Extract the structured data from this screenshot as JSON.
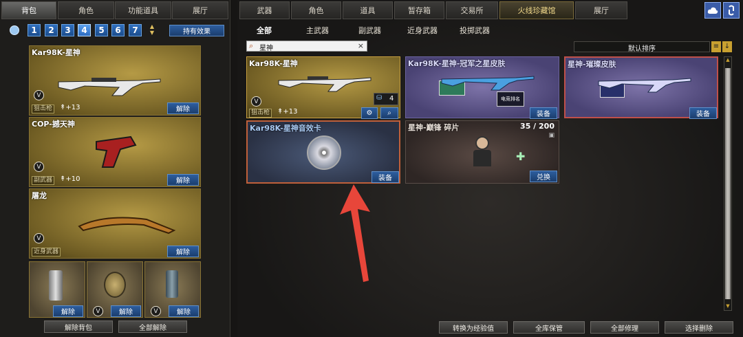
{
  "left": {
    "tabs": [
      "背包",
      "角色",
      "功能道具",
      "展厅"
    ],
    "bag_numbers": [
      "1",
      "2",
      "3",
      "4",
      "5",
      "6",
      "7"
    ],
    "active_bag": "4",
    "effect_btn": "持有效果",
    "slots": [
      {
        "name": "Kar98K-星神",
        "type": "狙击枪",
        "enh": "+13",
        "btn": "解除"
      },
      {
        "name": "COP-撼天神",
        "type": "副武器",
        "enh": "+10",
        "btn": "解除"
      },
      {
        "name": "屠龙",
        "type": "近身武器",
        "btn": "解除"
      }
    ],
    "grenades": [
      {
        "btn": "解除"
      },
      {
        "btn": "解除"
      },
      {
        "btn": "解除"
      }
    ],
    "bottom_buttons": [
      "解除背包",
      "全部解除"
    ]
  },
  "right": {
    "tabs": [
      "武器",
      "角色",
      "道具",
      "暂存箱",
      "交易所",
      "火线珍藏馆",
      "展厅"
    ],
    "subtabs": [
      "全部",
      "主武器",
      "副武器",
      "近身武器",
      "投掷武器"
    ],
    "search": {
      "value": "星神",
      "clear": "×"
    },
    "sort": {
      "label": "默认排序"
    },
    "items": [
      {
        "name": "Kar98K-星神",
        "type": "狙击枪",
        "enh": "+13",
        "count": "4"
      },
      {
        "name": "Kar98K-星神-冠军之星皮肤",
        "btn": "装备",
        "emblem": "电竞排名"
      },
      {
        "name": "星神-璀璨皮肤",
        "btn": "装备"
      },
      {
        "name": "Kar98K-星神音效卡",
        "btn": "装备"
      },
      {
        "name": "星神-巅锋 碎片",
        "progress": "35 / 200",
        "current": 35,
        "total": 200,
        "btn": "兑换"
      }
    ],
    "bottom_buttons": [
      "转换为经验值",
      "全库保管",
      "全部修理",
      "选择删除"
    ]
  },
  "colors": {
    "accent_gold": "#f0d88a",
    "blue_button": "#2d5d9e",
    "arrow_red": "#e8463a"
  }
}
